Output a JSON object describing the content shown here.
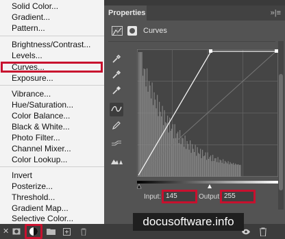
{
  "menu": {
    "items": [
      {
        "label": "Solid Color..."
      },
      {
        "label": "Gradient..."
      },
      {
        "label": "Pattern..."
      },
      {
        "label": "Brightness/Contrast..."
      },
      {
        "label": "Levels..."
      },
      {
        "label": "Curves..."
      },
      {
        "label": "Exposure..."
      },
      {
        "label": "Vibrance..."
      },
      {
        "label": "Hue/Saturation..."
      },
      {
        "label": "Color Balance..."
      },
      {
        "label": "Black & White..."
      },
      {
        "label": "Photo Filter..."
      },
      {
        "label": "Channel Mixer..."
      },
      {
        "label": "Color Lookup..."
      },
      {
        "label": "Invert"
      },
      {
        "label": "Posterize..."
      },
      {
        "label": "Threshold..."
      },
      {
        "label": "Gradient Map..."
      },
      {
        "label": "Selective Color..."
      }
    ],
    "highlighted": "Curves...",
    "highlight_color": "#c8102e"
  },
  "properties": {
    "tab_label": "Properties",
    "menu_glyph": "»|≡",
    "adjustment_name": "Curves",
    "input_label": "Input:",
    "input_value": "145",
    "output_label": "Output:",
    "output_value": "255"
  },
  "bottom_toolbar": {
    "icons": [
      "close-icon",
      "layer-mask-icon",
      "adjustment-layer-icon",
      "folder-icon",
      "new-layer-icon",
      "trash-icon",
      "visibility-icon",
      "delete-icon"
    ]
  },
  "watermark": "docusoftware.info"
}
